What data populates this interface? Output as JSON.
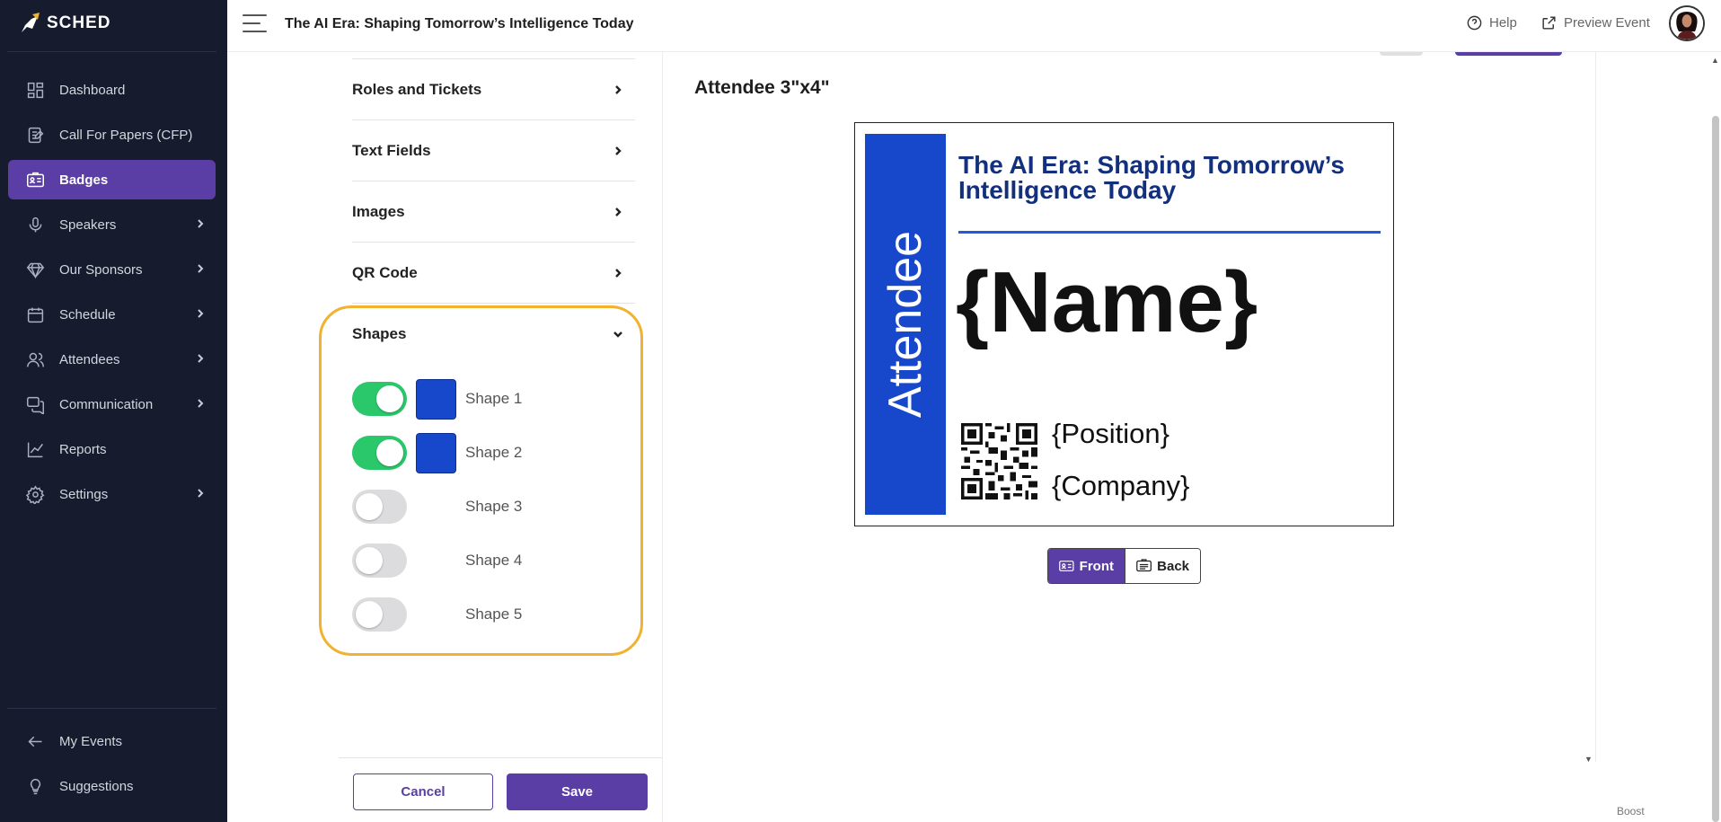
{
  "app": {
    "logo_text": "SCHED"
  },
  "sidebar": {
    "items": [
      {
        "label": "Dashboard",
        "icon": "dashboard-icon",
        "active": false,
        "has_chevron": false
      },
      {
        "label": "Call For Papers (CFP)",
        "icon": "document-icon",
        "active": false,
        "has_chevron": false
      },
      {
        "label": "Badges",
        "icon": "badge-icon",
        "active": true,
        "has_chevron": false
      },
      {
        "label": "Speakers",
        "icon": "microphone-icon",
        "active": false,
        "has_chevron": true
      },
      {
        "label": "Our Sponsors",
        "icon": "diamond-icon",
        "active": false,
        "has_chevron": true
      },
      {
        "label": "Schedule",
        "icon": "calendar-icon",
        "active": false,
        "has_chevron": true
      },
      {
        "label": "Attendees",
        "icon": "users-icon",
        "active": false,
        "has_chevron": true
      },
      {
        "label": "Communication",
        "icon": "chat-icon",
        "active": false,
        "has_chevron": true
      },
      {
        "label": "Reports",
        "icon": "chart-icon",
        "active": false,
        "has_chevron": false
      },
      {
        "label": "Settings",
        "icon": "gear-icon",
        "active": false,
        "has_chevron": true
      }
    ],
    "bottom_items": [
      {
        "label": "My Events",
        "icon": "arrow-left-icon"
      },
      {
        "label": "Suggestions",
        "icon": "lightbulb-icon"
      }
    ]
  },
  "topbar": {
    "event_title": "The AI Era: Shaping Tomorrow’s Intelligence Today",
    "help_label": "Help",
    "preview_label": "Preview Event"
  },
  "settings_panel": {
    "sections": [
      "Roles and Tickets",
      "Text Fields",
      "Images",
      "QR Code"
    ],
    "shapes_section": {
      "title": "Shapes",
      "expanded": true,
      "shapes": [
        {
          "label": "Shape 1",
          "enabled": true,
          "color": "#1748cc"
        },
        {
          "label": "Shape 2",
          "enabled": true,
          "color": "#1748cc"
        },
        {
          "label": "Shape 3",
          "enabled": false,
          "color": ""
        },
        {
          "label": "Shape 4",
          "enabled": false,
          "color": ""
        },
        {
          "label": "Shape 5",
          "enabled": false,
          "color": ""
        }
      ]
    },
    "cancel_label": "Cancel",
    "save_label": "Save"
  },
  "preview": {
    "title": "Attendee 3\"x4\"",
    "badge": {
      "role_text": "Attendee",
      "event_name": "The AI Era: Shaping Tomorrow’s Intelligence Today",
      "name_placeholder": "{Name}",
      "position_placeholder": "{Position}",
      "company_placeholder": "{Company}",
      "accent_color": "#1748cc",
      "title_color": "#12307e"
    },
    "front_label": "Front",
    "back_label": "Back",
    "selected_side": "Front"
  },
  "footer": {
    "boost_label": "Boost"
  },
  "colors": {
    "sidebar_bg": "#161b2e",
    "accent_purple": "#5b3da6",
    "toggle_on": "#2bc76b",
    "highlight_ring": "#f2b12f"
  }
}
